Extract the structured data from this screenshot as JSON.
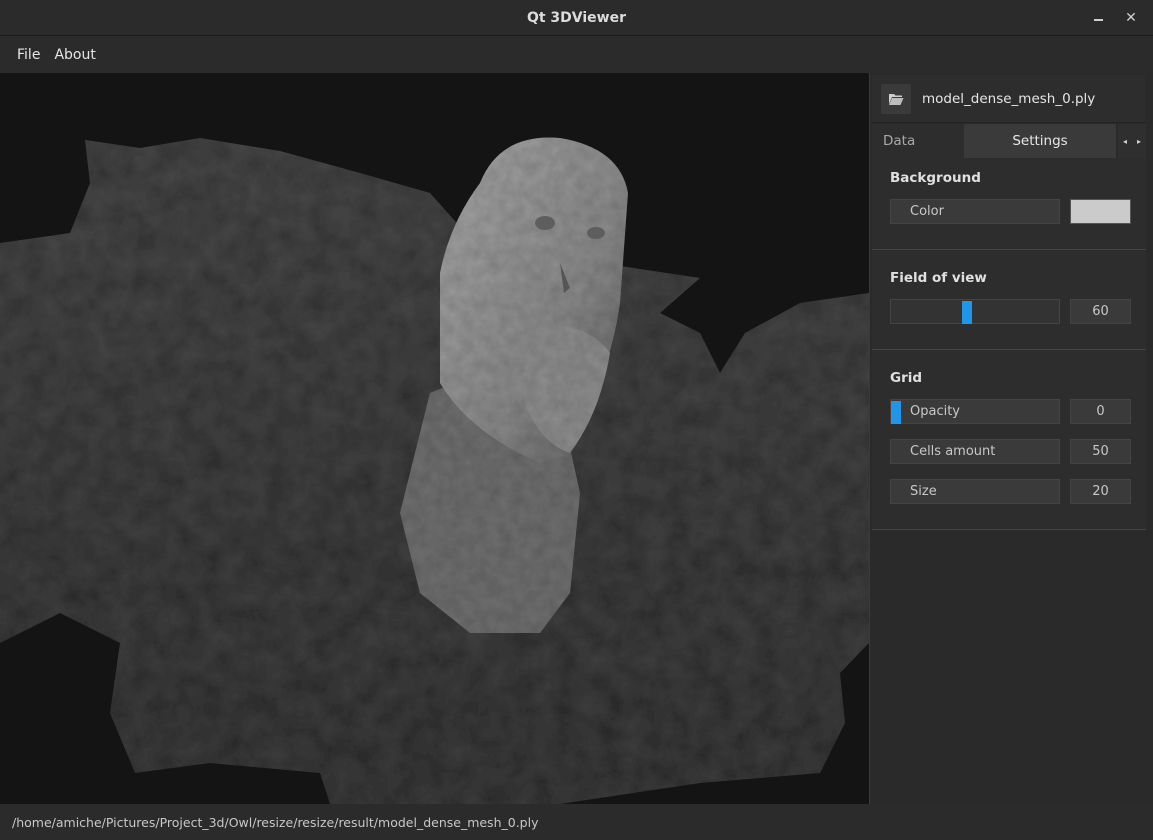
{
  "window": {
    "title": "Qt 3DViewer",
    "minimize_icon": "minimize-icon",
    "close_icon": "close-icon",
    "close_glyph": "✕"
  },
  "menu": {
    "items": [
      "File",
      "About"
    ]
  },
  "file_panel": {
    "icon": "folder-open-icon",
    "filename": "model_dense_mesh_0.ply"
  },
  "tabs": {
    "items": [
      "Data",
      "Settings"
    ],
    "active": "Settings",
    "scroll_left_icon": "chevron-left-icon",
    "scroll_right_icon": "chevron-right-icon",
    "scroll_left_glyph": "◂",
    "scroll_right_glyph": "▸"
  },
  "settings": {
    "background": {
      "title": "Background",
      "color_label": "Color",
      "color_value": "#cbcbcb"
    },
    "field_of_view": {
      "title": "Field of view",
      "value": "60",
      "slider_fraction": 0.45
    },
    "grid": {
      "title": "Grid",
      "opacity_label": "Opacity",
      "opacity_value": "0",
      "cells_label": "Cells amount",
      "cells_value": "50",
      "size_label": "Size",
      "size_value": "20"
    }
  },
  "status": {
    "path": "/home/amiche/Pictures/Project_3d/Owl/resize/resize/result/model_dense_mesh_0.ply"
  },
  "colors": {
    "accent": "#2196e8",
    "viewport_bg": "#141414",
    "panel_bg": "#2d2d2d"
  }
}
